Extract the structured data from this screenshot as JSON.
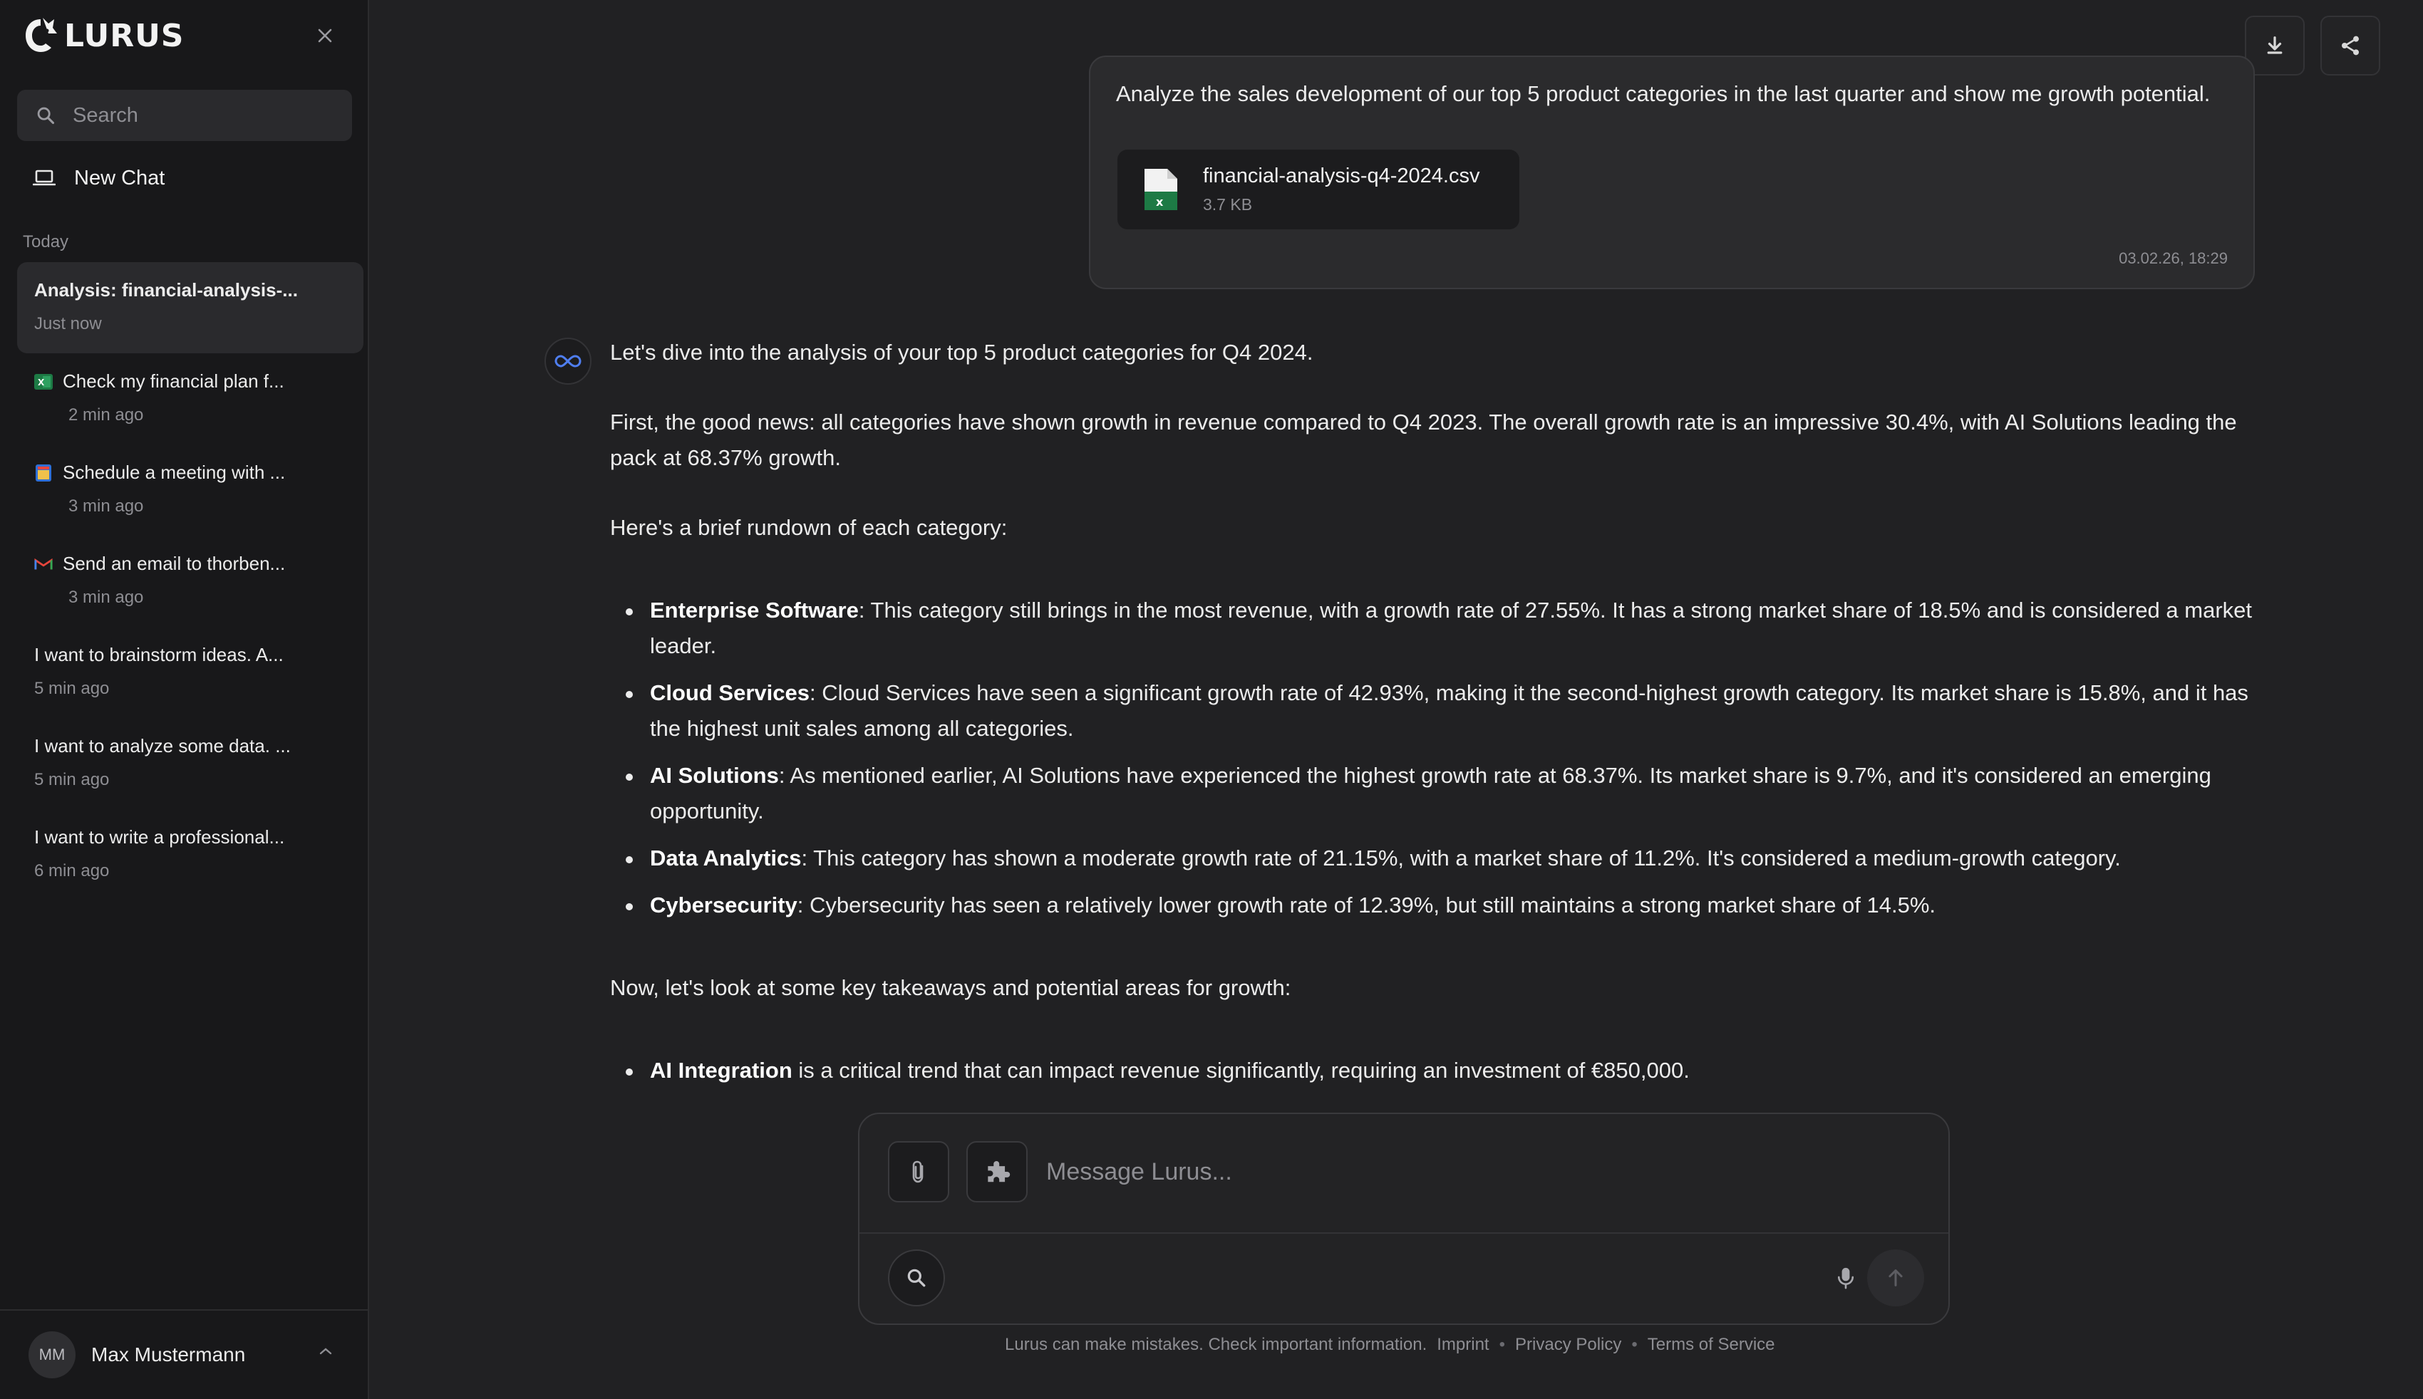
{
  "app": {
    "brand": "LURUS"
  },
  "sidebar": {
    "search_placeholder": "Search",
    "new_chat": "New Chat",
    "section_today": "Today",
    "chats": [
      {
        "title": "Analysis: financial-analysis-...",
        "time": "Just now",
        "icon": "",
        "active": true
      },
      {
        "title": "Check my financial plan f...",
        "time": "2 min ago",
        "icon": "excel-icon",
        "active": false
      },
      {
        "title": "Schedule a meeting with ...",
        "time": "3 min ago",
        "icon": "calendar-icon",
        "active": false
      },
      {
        "title": "Send an email to thorben...",
        "time": "3 min ago",
        "icon": "gmail-icon",
        "active": false
      },
      {
        "title": "I want to brainstorm ideas. A...",
        "time": "5 min ago",
        "icon": "",
        "active": false
      },
      {
        "title": "I want to analyze some data. ...",
        "time": "5 min ago",
        "icon": "",
        "active": false
      },
      {
        "title": "I want to write a professional...",
        "time": "6 min ago",
        "icon": "",
        "active": false
      }
    ],
    "user": {
      "initials": "MM",
      "name": "Max Mustermann"
    }
  },
  "conversation": {
    "user_message": {
      "text": "Analyze the sales development of our top 5 product categories in the last quarter and show me growth potential.",
      "file_name": "financial-analysis-q4-2024.csv",
      "file_size": "3.7 KB",
      "timestamp": "03.02.26, 18:29"
    },
    "assistant": {
      "intro": "Let's dive into the analysis of your top 5 product categories for Q4 2024.",
      "paragraph2": "First, the good news: all categories have shown growth in revenue compared to Q4 2023. The overall growth rate is an impressive 30.4%, with AI Solutions leading the pack at 68.37% growth.",
      "paragraph3": "Here's a brief rundown of each category:",
      "categories": [
        {
          "name": "Enterprise Software",
          "text": ": This category still brings in the most revenue, with a growth rate of 27.55%. It has a strong market share of 18.5% and is considered a market leader."
        },
        {
          "name": "Cloud Services",
          "text": ": Cloud Services have seen a significant growth rate of 42.93%, making it the second-highest growth category. Its market share is 15.8%, and it has the highest unit sales among all categories."
        },
        {
          "name": "AI Solutions",
          "text": ": As mentioned earlier, AI Solutions have experienced the highest growth rate at 68.37%. Its market share is 9.7%, and it's considered an emerging opportunity."
        },
        {
          "name": "Data Analytics",
          "text": ": This category has shown a moderate growth rate of 21.15%, with a market share of 11.2%. It's considered a medium-growth category."
        },
        {
          "name": "Cybersecurity",
          "text": ": Cybersecurity has seen a relatively lower growth rate of 12.39%, but still maintains a strong market share of 14.5%."
        }
      ],
      "paragraph4": "Now, let's look at some key takeaways and potential areas for growth:",
      "takeaways": [
        {
          "name": "AI Integration",
          "text": " is a critical trend that can impact revenue significantly, requiring an investment of €850,000."
        }
      ]
    }
  },
  "composer": {
    "placeholder": "Message Lurus..."
  },
  "footer": {
    "disclaimer": "Lurus can make mistakes. Check important information.",
    "imprint": "Imprint",
    "privacy": "Privacy Policy",
    "terms": "Terms of Service"
  }
}
